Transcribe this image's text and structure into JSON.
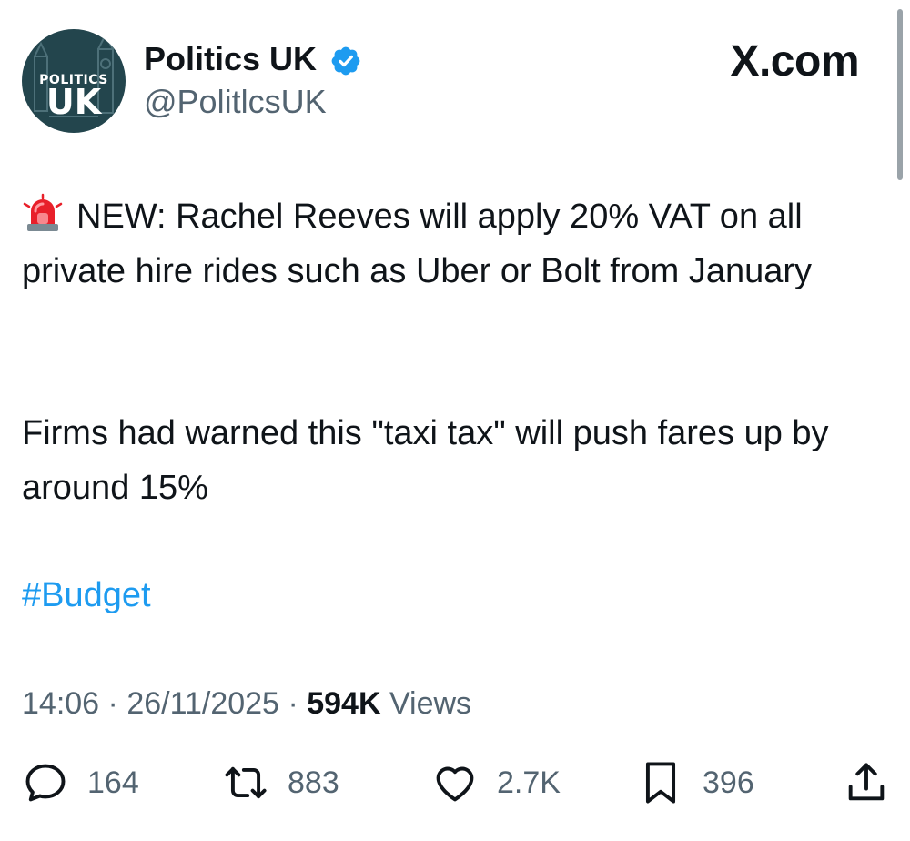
{
  "author": {
    "display_name": "Politics UK",
    "handle": "@PolitlcsUK",
    "avatar_text_small": "POLITICS",
    "avatar_text_big": "UK",
    "verified": true
  },
  "brand": "X.com",
  "tweet": {
    "paragraph1": "NEW: Rachel Reeves will apply 20% VAT on all private hire rides such as Uber or Bolt from January",
    "paragraph2": "Firms had warned this \"taxi tax\" will push fares up by around 15%",
    "hashtag": "#Budget"
  },
  "meta": {
    "time": "14:06",
    "separator": "·",
    "date": "26/11/2025",
    "views_count": "594K",
    "views_label": "Views"
  },
  "actions": {
    "replies": "164",
    "reposts": "883",
    "likes": "2.7K",
    "bookmarks": "396"
  },
  "colors": {
    "link": "#1d9bf0",
    "secondary_text": "#536471",
    "avatar_bg": "#23454d",
    "verified_badge": "#1d9bf0"
  },
  "icons": [
    "siren-emoji-icon",
    "verified-badge-icon",
    "reply-icon",
    "repost-icon",
    "like-icon",
    "bookmark-icon",
    "share-icon"
  ]
}
